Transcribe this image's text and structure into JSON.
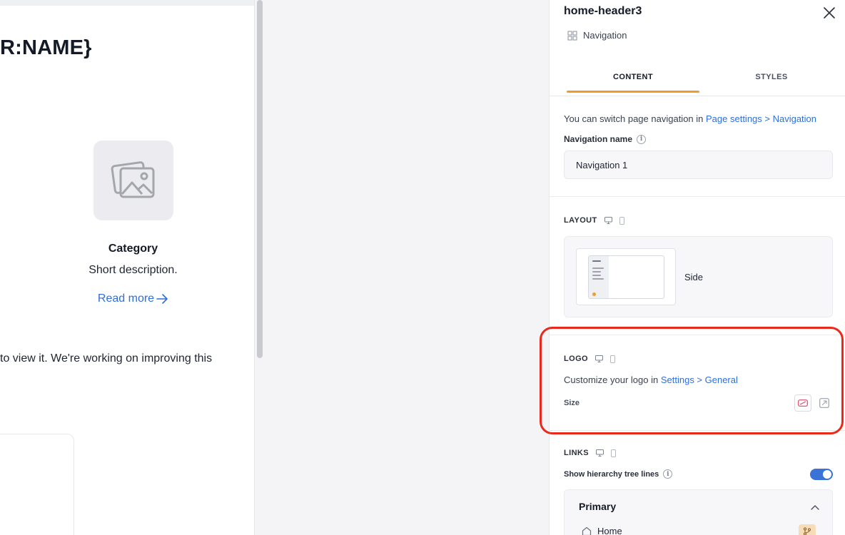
{
  "canvas": {
    "heading": "R:NAME}",
    "category_title": "Category",
    "category_description": "Short description.",
    "read_more": "Read more",
    "notice": "to view it. We're working on improving this"
  },
  "panel": {
    "title": "home-header3",
    "element_type": "Navigation",
    "tabs": [
      {
        "label": "CONTENT",
        "active": true
      },
      {
        "label": "STYLES",
        "active": false
      }
    ],
    "switch_note": {
      "text": "You can switch page navigation in ",
      "link": "Page settings > Navigation"
    },
    "navigation_name": {
      "label": "Navigation name",
      "value": "Navigation 1"
    },
    "layout": {
      "heading": "LAYOUT",
      "selected": "Side"
    },
    "logo": {
      "heading": "LOGO",
      "note_text": "Customize your logo in ",
      "note_link": "Settings > General",
      "size_label": "Size"
    },
    "links": {
      "heading": "LINKS",
      "tree_lines_label": "Show hierarchy tree lines",
      "tree_lines_enabled": true,
      "group_title": "Primary",
      "items": [
        {
          "label": "Home"
        }
      ]
    }
  },
  "colors": {
    "accent_tab": "#f09c2a",
    "link": "#2f6fdc",
    "toggle_on": "#3a72d8",
    "highlight_annotation": "#e8291c"
  }
}
